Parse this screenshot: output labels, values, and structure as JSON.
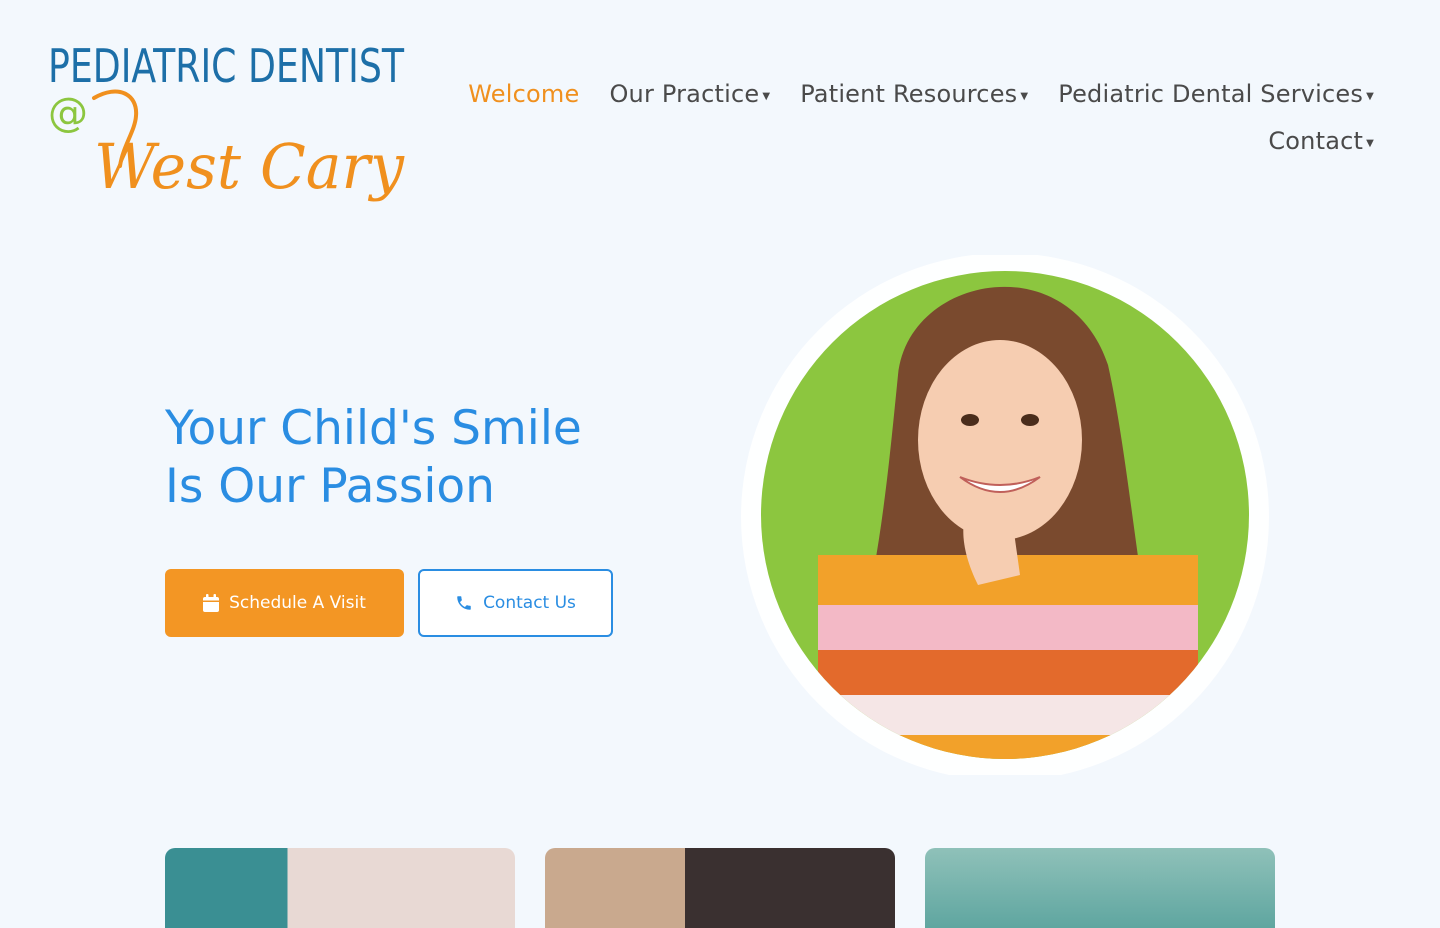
{
  "brand": {
    "line1": "PEDIATRIC DENTIST",
    "at": "@",
    "line2": "West Cary"
  },
  "nav": {
    "items": [
      {
        "label": "Welcome",
        "active": true,
        "dropdown": false
      },
      {
        "label": "Our Practice",
        "active": false,
        "dropdown": true
      },
      {
        "label": "Patient Resources",
        "active": false,
        "dropdown": true
      },
      {
        "label": "Pediatric Dental Services",
        "active": false,
        "dropdown": true
      },
      {
        "label": "Contact",
        "active": false,
        "dropdown": true
      }
    ]
  },
  "hero": {
    "title_line1": "Your Child's Smile",
    "title_line2": "Is Our Passion",
    "primary_button": "Schedule A Visit",
    "secondary_button": "Contact Us"
  },
  "colors": {
    "accent_orange": "#f39624",
    "accent_blue": "#2a8de2",
    "photo_bg_green": "#8cc63f"
  },
  "icons": {
    "calendar": "calendar-icon",
    "phone": "phone-icon"
  }
}
